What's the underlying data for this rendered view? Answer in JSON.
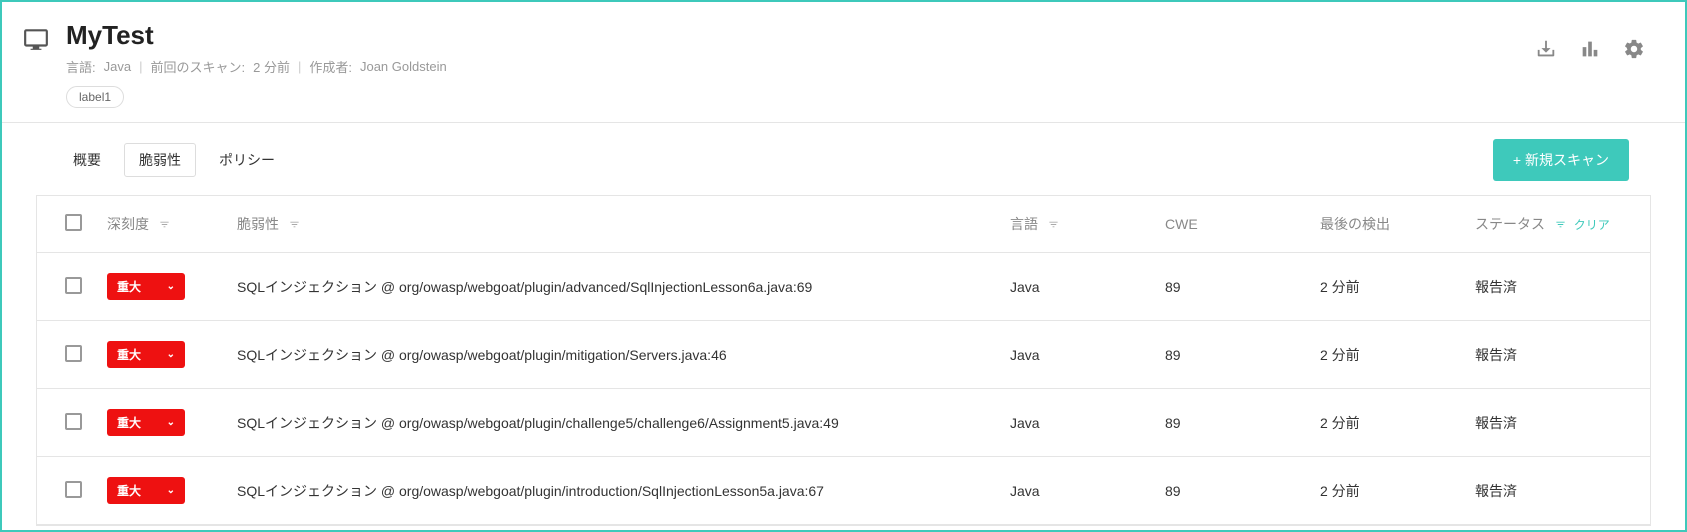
{
  "header": {
    "title": "MyTest",
    "meta": {
      "lang_label": "言語:",
      "lang_value": "Java",
      "scan_label": "前回のスキャン:",
      "scan_value": "2 分前",
      "author_label": "作成者:",
      "author_value": "Joan Goldstein"
    },
    "labels": [
      "label1"
    ]
  },
  "tabs": {
    "overview": "概要",
    "vulns": "脆弱性",
    "policy": "ポリシー"
  },
  "new_scan": "+ 新規スキャン",
  "columns": {
    "severity": "深刻度",
    "vuln": "脆弱性",
    "lang": "言語",
    "cwe": "CWE",
    "last": "最後の検出",
    "status": "ステータス",
    "clear": "クリア"
  },
  "rows": [
    {
      "severity": "重大",
      "vuln": "SQLインジェクション @ org/owasp/webgoat/plugin/advanced/SqlInjectionLesson6a.java:69",
      "lang": "Java",
      "cwe": "89",
      "last": "2 分前",
      "status": "報告済"
    },
    {
      "severity": "重大",
      "vuln": "SQLインジェクション @ org/owasp/webgoat/plugin/mitigation/Servers.java:46",
      "lang": "Java",
      "cwe": "89",
      "last": "2 分前",
      "status": "報告済"
    },
    {
      "severity": "重大",
      "vuln": "SQLインジェクション @ org/owasp/webgoat/plugin/challenge5/challenge6/Assignment5.java:49",
      "lang": "Java",
      "cwe": "89",
      "last": "2 分前",
      "status": "報告済"
    },
    {
      "severity": "重大",
      "vuln": "SQLインジェクション @ org/owasp/webgoat/plugin/introduction/SqlInjectionLesson5a.java:67",
      "lang": "Java",
      "cwe": "89",
      "last": "2 分前",
      "status": "報告済"
    }
  ]
}
